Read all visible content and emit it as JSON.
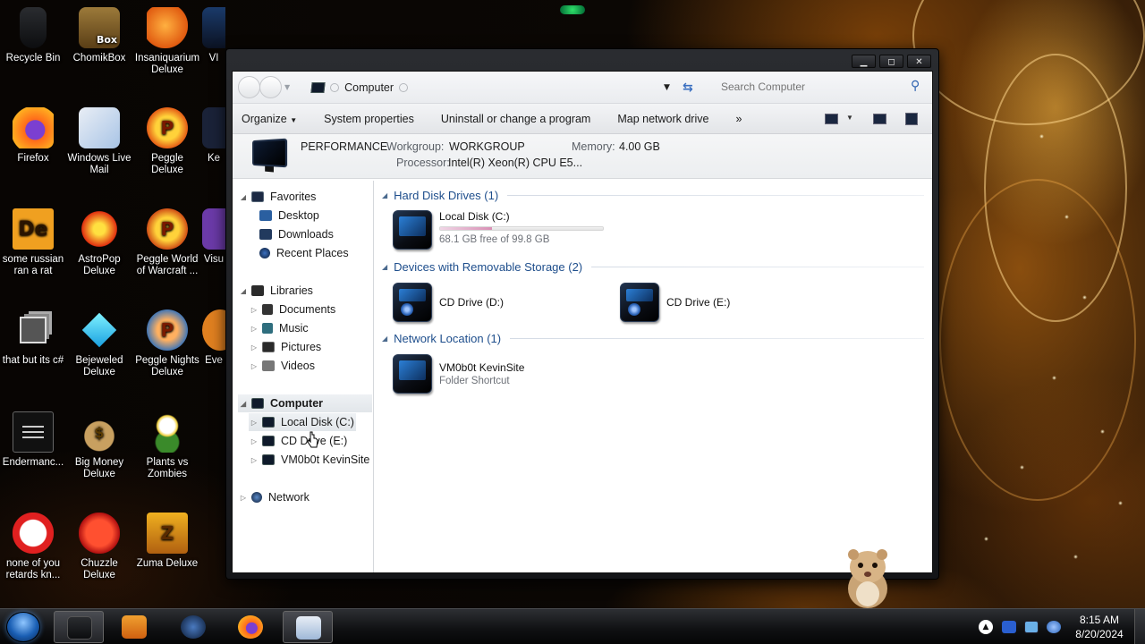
{
  "desktop": {
    "icons": [
      {
        "label": "Recycle Bin"
      },
      {
        "label": "ChomikBox",
        "badge": "Box"
      },
      {
        "label": "Insaniquarium Deluxe"
      },
      {
        "label": "Firefox"
      },
      {
        "label": "Windows Live Mail"
      },
      {
        "label": "Peggle Deluxe"
      },
      {
        "label": "some russian ran a rat",
        "badge": "De"
      },
      {
        "label": "AstroPop Deluxe"
      },
      {
        "label": "Peggle World of Warcraft ..."
      },
      {
        "label": "that but its c#"
      },
      {
        "label": "Bejeweled Deluxe"
      },
      {
        "label": "Peggle Nights Deluxe"
      },
      {
        "label": "Endermanc..."
      },
      {
        "label": "Big Money Deluxe"
      },
      {
        "label": "Plants vs Zombies"
      },
      {
        "label": "none of you retards kn..."
      },
      {
        "label": "Chuzzle Deluxe"
      },
      {
        "label": "Zuma Deluxe"
      }
    ],
    "partial_icons": [
      "VI",
      "Ke",
      "Ke",
      "Visu",
      "Eve"
    ]
  },
  "explorer": {
    "window_buttons": {
      "minimize": "▁",
      "maximize": "◻",
      "close": "✕"
    },
    "address": {
      "location": "Computer",
      "search_placeholder": "Search Computer"
    },
    "commands": {
      "organize": "Organize",
      "system_properties": "System properties",
      "uninstall": "Uninstall or change a program",
      "map_drive": "Map network drive",
      "more": "»"
    },
    "details": {
      "computer_name": "PERFORMANCE",
      "workgroup_label": "Workgroup:",
      "workgroup": "WORKGROUP",
      "memory_label": "Memory:",
      "memory": "4.00 GB",
      "processor_label": "Processor:",
      "processor": "Intel(R) Xeon(R) CPU E5..."
    },
    "nav": {
      "favorites": "Favorites",
      "desktop": "Desktop",
      "downloads": "Downloads",
      "recent": "Recent Places",
      "libraries": "Libraries",
      "documents": "Documents",
      "music": "Music",
      "pictures": "Pictures",
      "videos": "Videos",
      "computer": "Computer",
      "local_disk": "Local Disk (C:)",
      "cd_drive": "CD Drive (E:)",
      "kevinsite": "VM0b0t KevinSite",
      "network": "Network"
    },
    "groups": {
      "hdd": "Hard Disk Drives (1)",
      "removable": "Devices with Removable Storage (2)",
      "network": "Network Location (1)"
    },
    "drives": {
      "c_name": "Local Disk (C:)",
      "c_free": "68.1 GB free of 99.8 GB",
      "c_used_fraction": 0.318,
      "d_name": "CD Drive (D:)",
      "e_name": "CD Drive (E:)",
      "net_name": "VM0b0t KevinSite",
      "net_type": "Folder Shortcut"
    }
  },
  "taskbar": {
    "time": "8:15 AM",
    "date": "8/20/2024",
    "tray_arrow": "▲"
  },
  "colors": {
    "accent_blue": "#1e4e8c",
    "usage_fill": "#d98fb5"
  }
}
